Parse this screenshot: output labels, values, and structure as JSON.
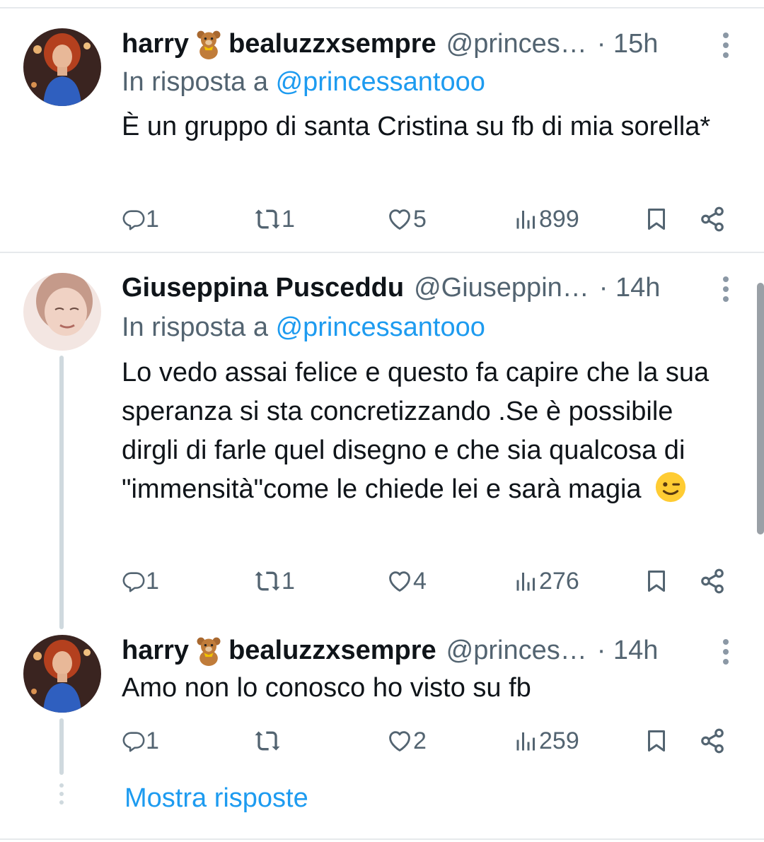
{
  "tweets": [
    {
      "display_name_1": "harry",
      "display_name_2": "bealuzzxsempre",
      "handle": "@princes…",
      "time": "· 15h",
      "reply_label": "In risposta a",
      "reply_mention": "@princessantooo",
      "text": "È un gruppo di santa Cristina su fb di mia sorella*",
      "replies": "1",
      "retweets": "1",
      "likes": "5",
      "views": "899"
    },
    {
      "display_name": "Giuseppina Pusceddu",
      "handle": "@Giuseppin…",
      "time": "· 14h",
      "reply_label": "In risposta a",
      "reply_mention": "@princessantooo",
      "text": "Lo vedo assai felice e questo fa capire che la sua speranza si sta concretizzando .Se è possibile dirgli di farle quel disegno e che sia qualcosa di \"immensità\"come le chiede lei e sarà magia",
      "replies": "1",
      "retweets": "1",
      "likes": "4",
      "views": "276"
    },
    {
      "display_name_1": "harry",
      "display_name_2": "bealuzzxsempre",
      "handle": "@princes…",
      "time": "· 14h",
      "text": "Amo non lo conosco ho visto su fb",
      "replies": "1",
      "retweets": "",
      "likes": "2",
      "views": "259"
    }
  ],
  "show_replies": "Mostra risposte",
  "icons": [
    "reply-icon",
    "retweet-icon",
    "like-icon",
    "views-icon",
    "bookmark-icon",
    "share-icon",
    "more-icon",
    "bear-emoji-icon",
    "wink-emoji-icon"
  ],
  "colors": {
    "link": "#1d9bf0",
    "secondary": "#536471",
    "text": "#0f1419",
    "thread": "#cfd9de"
  }
}
